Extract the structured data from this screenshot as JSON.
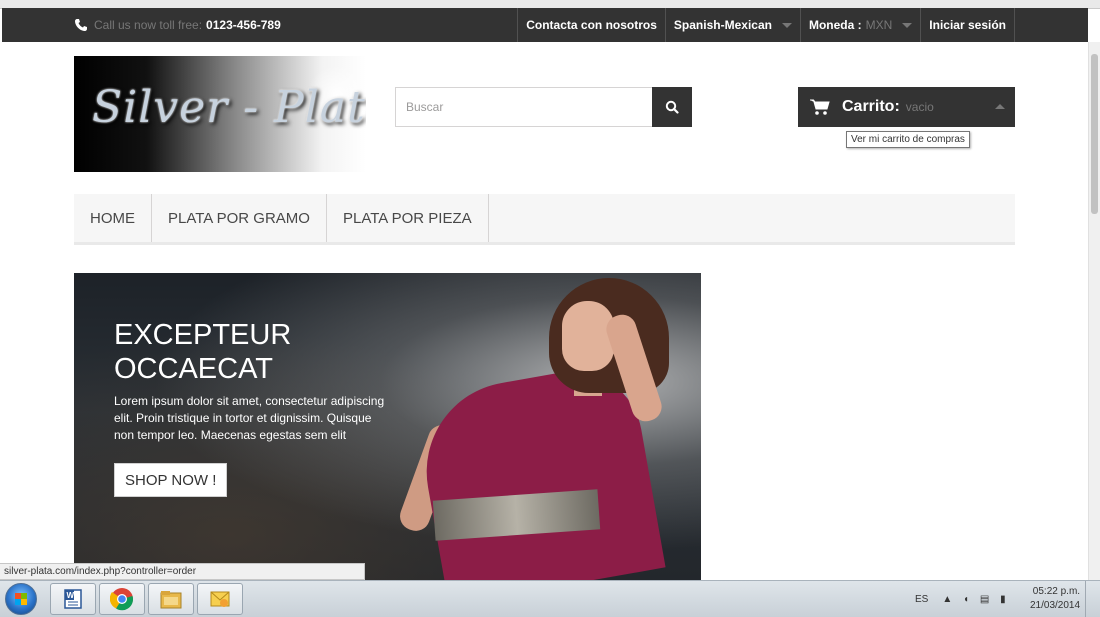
{
  "topbar": {
    "call_label": "Call us now toll free:",
    "phone": "0123-456-789",
    "contact": "Contacta con nosotros",
    "language": "Spanish-Mexican",
    "currency_label": "Moneda :",
    "currency_value": "MXN",
    "login": "Iniciar sesión"
  },
  "header": {
    "logo_text": "Silver - Plata",
    "search_placeholder": "Buscar",
    "cart_label": "Carrito:",
    "cart_status": "vacio",
    "cart_tooltip": "Ver mi carrito de compras"
  },
  "menu": {
    "items": [
      "HOME",
      "PLATA POR GRAMO",
      "PLATA POR PIEZA"
    ]
  },
  "slider": {
    "title": "EXCEPTEUR\nOCCAECAT",
    "description": "Lorem ipsum dolor sit amet, consectetur adipiscing elit. Proin tristique in tortor et dignissim. Quisque non tempor leo. Maecenas egestas sem elit",
    "button": "SHOP NOW !"
  },
  "status_url": "silver-plata.com/index.php?controller=order",
  "taskbar": {
    "language": "ES",
    "time": "05:22 p.m.",
    "date": "21/03/2014",
    "apps": [
      "word-icon",
      "chrome-icon",
      "file-explorer-icon",
      "outlook-icon"
    ]
  },
  "colors": {
    "dark": "#333333",
    "muted": "#777777",
    "menu_bg": "#f6f6f6",
    "slider_accent": "#8c1d47"
  }
}
